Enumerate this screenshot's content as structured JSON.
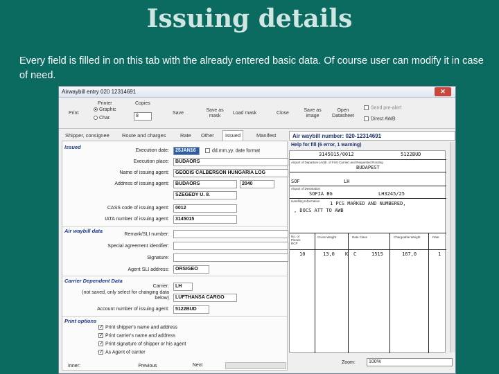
{
  "slide": {
    "title": "Issuing details",
    "description": "Every  field is filled in on this tab with the already entered basic data. Of course user can modify it in case of need."
  },
  "window": {
    "title": "Airwaybill entry   020 12314691",
    "close_glyph": "✕"
  },
  "toolbar": {
    "print_label": "Print",
    "printer_label": "Printer",
    "graphic_label": "Graphic",
    "char_label": "Char.",
    "copies_label": "Copies",
    "copies_value": "8",
    "save_label": "Save",
    "save_as_mask_label": "Save as mask",
    "load_mask_label": "Load mask",
    "close_label": "Close",
    "save_as_image_label": "Save as image",
    "open_datasheet_label": "Open Datasheet",
    "send_pre_alert_label": "Send pre-alert",
    "direct_awb_label": "Direct AWB"
  },
  "tabs": [
    {
      "label": "Shipper, consignee"
    },
    {
      "label": "Route and charges"
    },
    {
      "label": "Rate"
    },
    {
      "label": "Other"
    },
    {
      "label": "Issued"
    },
    {
      "label": "Manifest"
    }
  ],
  "issued": {
    "section": "Issued",
    "execution_date_label": "Execution date:",
    "execution_date_value": "25JAN16",
    "date_format_label": "dd.mm.yy. date format",
    "execution_place_label": "Execution place:",
    "execution_place_value": "BUDAÖRS",
    "issuing_agent_name_label": "Name of issuing agent:",
    "issuing_agent_name_value": "GEODIS CALBERSON HUNGARIA LOG",
    "issuing_agent_address_label": "Address of issuing agent:",
    "issuing_agent_address_value": "BUDAÖRS",
    "issuing_agent_zip_value": "2040",
    "issuing_agent_person_value": "SZEGEDY U. 8.",
    "cass_code_label": "CASS code of issuing agent:",
    "cass_code_value": "0012",
    "iata_number_label": "IATA number of issuing agent:",
    "iata_number_value": "3145015"
  },
  "awb_data": {
    "section": "Air waybill data",
    "remark_label": "Remark/SLI number:",
    "special_agreement_label": "Special agreement identifier:",
    "signature_label": "Signature:",
    "agent_sli_label": "Agent SLI address:",
    "agent_sli_value": "ORSIGEO"
  },
  "carrier": {
    "section": "Carrier Dependent Data",
    "carrier_label": "Carrier:",
    "carrier_value": "LH",
    "note_label": "(not saved, only select for changing data below)",
    "carrier_name_value": "LUFTHANSA CARGO",
    "account_label": "Account number of issuing agent:",
    "account_value": "5122BUD"
  },
  "print_options": {
    "section": "Print options",
    "items": [
      {
        "label": "Print shipper's name and address"
      },
      {
        "label": "Print carrier's name and address"
      },
      {
        "label": "Print signature of shipper or his agent"
      },
      {
        "label": "As Agent of carrier"
      }
    ],
    "check_glyph": "✓"
  },
  "bottom": {
    "inner_label": "Inner:",
    "previous_label": "Previous",
    "next_label": "Next"
  },
  "preview": {
    "awb_number_label": "Air waybill number: 020-12314691",
    "help_label": "Help for fill (6 error, 1 warning)",
    "iata_value": "3145015/0012",
    "account_value": "5122BUD",
    "departure_caption": "Airport of Departure (Addr. of First Carrier) and Requested Routing",
    "departure_value": "BUDAPEST",
    "to_value": "SOF",
    "carrier_value": "LH",
    "destination_caption": "Airport of Destination",
    "destination_value": "SOFIA BG",
    "flight_value": "LH3245/25",
    "handling_caption": "Handling Information",
    "handling_line1": "1 PCS MARKED AND NUMBERED,",
    "handling_line2": ", DOCS ATT TO AWB",
    "pieces_caption": "No. of Pieces RCP",
    "gross_caption": "Gross Weight",
    "rate_class_caption": "Rate Class",
    "chargeable_caption": "Chargeable Weight",
    "rate_caption": "Rate",
    "pieces_value": "10",
    "gross_value": "13,0",
    "kg_value": "K",
    "class_value": "C",
    "commodity_value": "1515",
    "chargeable_value": "167,0",
    "rate_value": "1",
    "zoom_label": "Zoom:",
    "zoom_value": "100%"
  }
}
